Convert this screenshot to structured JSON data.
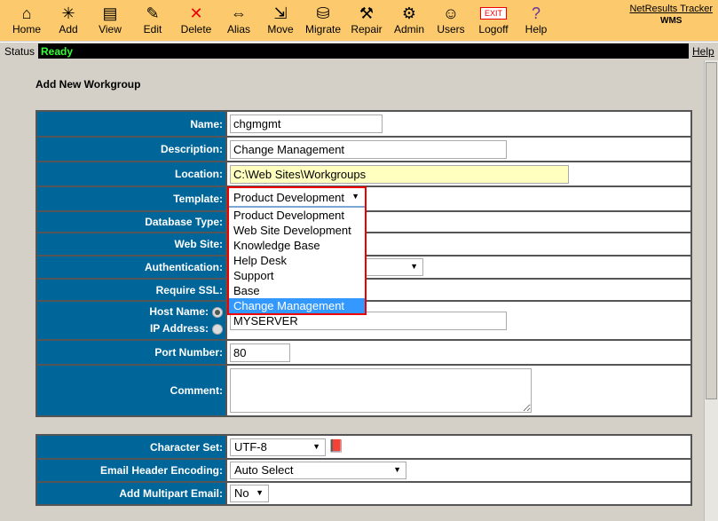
{
  "toolbar": {
    "items": [
      {
        "label": "Home",
        "icon": "home-icon",
        "glyph": "⌂"
      },
      {
        "label": "Add",
        "icon": "add-icon",
        "glyph": "✳"
      },
      {
        "label": "View",
        "icon": "view-icon",
        "glyph": "▤"
      },
      {
        "label": "Edit",
        "icon": "edit-icon",
        "glyph": "✎"
      },
      {
        "label": "Delete",
        "icon": "delete-icon",
        "glyph": "✕"
      },
      {
        "label": "Alias",
        "icon": "alias-icon",
        "glyph": "⇔"
      },
      {
        "label": "Move",
        "icon": "move-icon",
        "glyph": "⇲"
      },
      {
        "label": "Migrate",
        "icon": "migrate-icon",
        "glyph": "⛁"
      },
      {
        "label": "Repair",
        "icon": "repair-icon",
        "glyph": "⚒"
      },
      {
        "label": "Admin",
        "icon": "admin-icon",
        "glyph": "⚙"
      },
      {
        "label": "Users",
        "icon": "users-icon",
        "glyph": "☺"
      },
      {
        "label": "Logoff",
        "icon": "exit-icon",
        "glyph": "EXIT"
      },
      {
        "label": "Help",
        "icon": "help-book-icon",
        "glyph": "?"
      }
    ],
    "brand": "NetResults Tracker",
    "brand_sub": "WMS"
  },
  "status": {
    "label": "Status",
    "value": "Ready",
    "help": "Help"
  },
  "page_title": "Add New Workgroup",
  "form": {
    "name_label": "Name:",
    "name": "chgmgmt",
    "description_label": "Description:",
    "description": "Change Management",
    "location_label": "Location:",
    "location": "C:\\Web Sites\\Workgroups",
    "template_label": "Template:",
    "template": "Product Development",
    "template_options": [
      "Product Development",
      "Web Site Development",
      "Knowledge Base",
      "Help Desk",
      "Support",
      "Base",
      "Change Management"
    ],
    "dbtype_label": "Database Type:",
    "website_label": "Web Site:",
    "auth_label": "Authentication:",
    "ssl_label": "Require SSL:",
    "host_label": "Host Name:",
    "ip_label": "IP Address:",
    "host": "MYSERVER",
    "port_label": "Port Number:",
    "port": "80",
    "comment_label": "Comment:"
  },
  "form2": {
    "charset_label": "Character Set:",
    "charset": "UTF-8",
    "email_label": "Email Header Encoding:",
    "email": "Auto Select",
    "multipart_label": "Add Multipart Email:",
    "multipart": "No"
  },
  "colors": {
    "toolbar": "#fcca6c",
    "label_bg": "#00669a",
    "status_text": "#33ff33",
    "highlight": "#3399ff",
    "dropdown_border": "#ee0000"
  }
}
